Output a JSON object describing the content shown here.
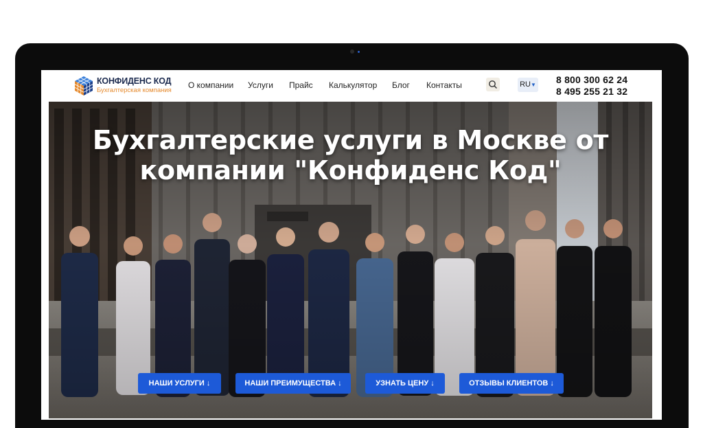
{
  "brand": {
    "name": "КОНФИДЕНС КОД",
    "tagline": "Бухгалтерская компания"
  },
  "nav": {
    "items": [
      {
        "label": "О компании"
      },
      {
        "label": "Услуги"
      },
      {
        "label": "Прайс"
      },
      {
        "label": "Калькулятор"
      },
      {
        "label": "Блог"
      },
      {
        "label": "Контакты"
      }
    ],
    "search_icon": "search-icon",
    "language": "RU",
    "phones": [
      "8 800 300 62 24",
      "8 495 255 21 32"
    ]
  },
  "hero": {
    "headline_line1": "Бухгалтерские услуги в Москве от",
    "headline_line2": "компании \"Конфиденс Код\"",
    "buttons": [
      {
        "label": "НАШИ УСЛУГИ ↓"
      },
      {
        "label": "НАШИ ПРЕИМУЩЕСТВА ↓"
      },
      {
        "label": "УЗНАТЬ ЦЕНУ ↓"
      },
      {
        "label": "ОТЗЫВЫ КЛИЕНТОВ ↓"
      }
    ]
  },
  "colors": {
    "accent": "#1d5ad8",
    "brand_navy": "#1b2a4e",
    "brand_orange": "#e58a2e",
    "device_frame": "#0c0c0c"
  }
}
